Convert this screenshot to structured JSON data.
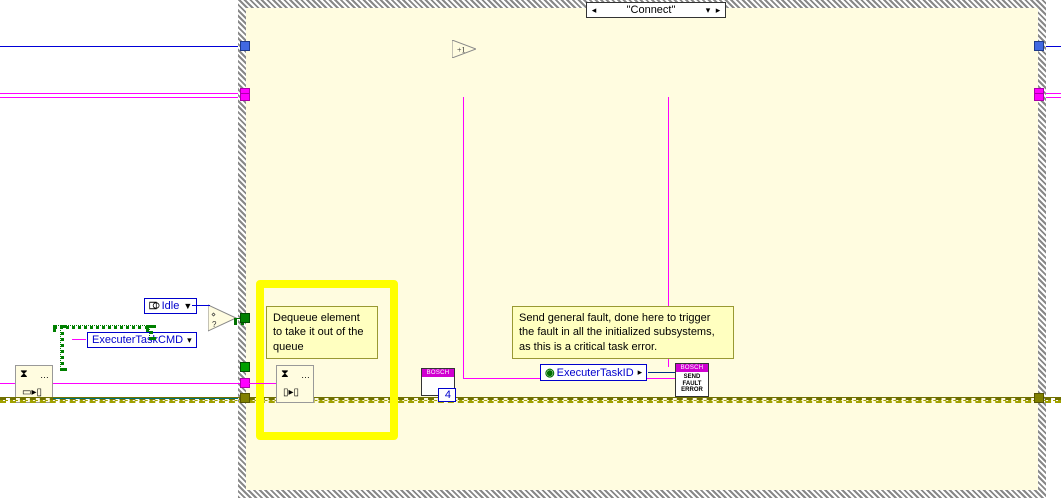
{
  "case": {
    "selector_label": "\"Connect\"",
    "incrementer_label": "+1"
  },
  "constants": {
    "idle_enum": "Idle",
    "executer_task_cmd": "ExecuterTaskCMD",
    "executer_task_id": "ExecuterTaskID",
    "four": "4"
  },
  "comments": {
    "dequeue": "Dequeue element to take it out of the queue",
    "fault": "Send general fault, done here to trigger the fault in all the initialized subsystems, as this is a critical task error."
  },
  "bosch": {
    "header": "BOSCH",
    "send_fault_error": "SEND\nFAULT\nERROR"
  }
}
